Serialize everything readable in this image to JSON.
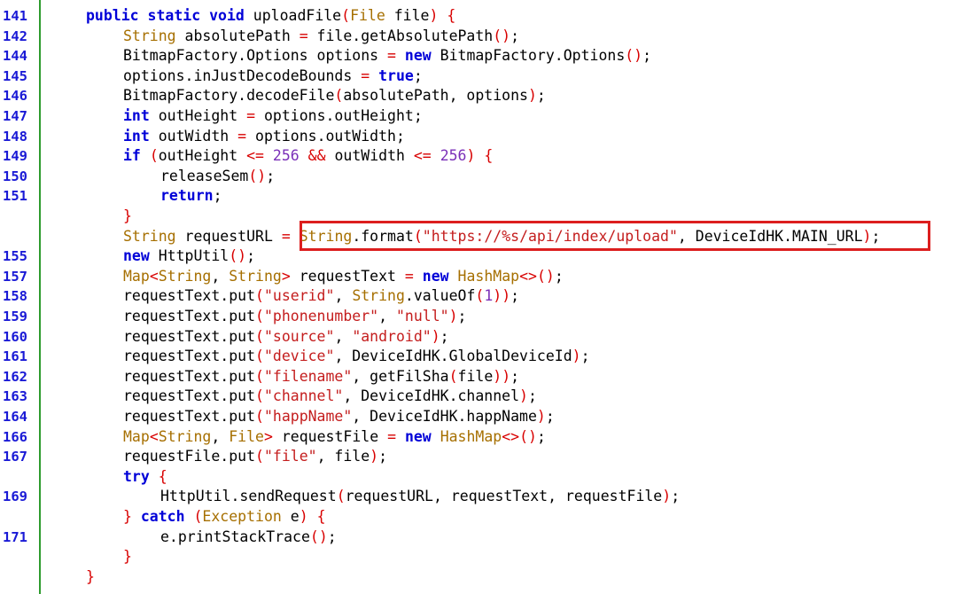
{
  "editor": {
    "lines": [
      {
        "num": "141",
        "indent": 0,
        "tokens": [
          [
            "kw",
            "public"
          ],
          [
            "p",
            " "
          ],
          [
            "kw",
            "static"
          ],
          [
            "p",
            " "
          ],
          [
            "kw",
            "void"
          ],
          [
            "p",
            " uploadFile"
          ],
          [
            "op",
            "("
          ],
          [
            "type",
            "File"
          ],
          [
            "p",
            " file"
          ],
          [
            "op",
            ")"
          ],
          [
            "p",
            " "
          ],
          [
            "op",
            "{"
          ]
        ]
      },
      {
        "num": "142",
        "indent": 1,
        "tokens": [
          [
            "type",
            "String"
          ],
          [
            "p",
            " absolutePath "
          ],
          [
            "op",
            "="
          ],
          [
            "p",
            " file.getAbsolutePath"
          ],
          [
            "op",
            "()"
          ],
          [
            "p",
            ";"
          ]
        ]
      },
      {
        "num": "144",
        "indent": 1,
        "tokens": [
          [
            "p",
            "BitmapFactory.Options options "
          ],
          [
            "op",
            "="
          ],
          [
            "p",
            " "
          ],
          [
            "kw",
            "new"
          ],
          [
            "p",
            " BitmapFactory.Options"
          ],
          [
            "op",
            "()"
          ],
          [
            "p",
            ";"
          ]
        ]
      },
      {
        "num": "145",
        "indent": 1,
        "tokens": [
          [
            "p",
            "options.inJustDecodeBounds "
          ],
          [
            "op",
            "="
          ],
          [
            "p",
            " "
          ],
          [
            "kw",
            "true"
          ],
          [
            "p",
            ";"
          ]
        ]
      },
      {
        "num": "146",
        "indent": 1,
        "tokens": [
          [
            "p",
            "BitmapFactory.decodeFile"
          ],
          [
            "op",
            "("
          ],
          [
            "p",
            "absolutePath, options"
          ],
          [
            "op",
            ")"
          ],
          [
            "p",
            ";"
          ]
        ]
      },
      {
        "num": "147",
        "indent": 1,
        "tokens": [
          [
            "kw",
            "int"
          ],
          [
            "p",
            " outHeight "
          ],
          [
            "op",
            "="
          ],
          [
            "p",
            " options.outHeight;"
          ]
        ]
      },
      {
        "num": "148",
        "indent": 1,
        "tokens": [
          [
            "kw",
            "int"
          ],
          [
            "p",
            " outWidth "
          ],
          [
            "op",
            "="
          ],
          [
            "p",
            " options.outWidth;"
          ]
        ]
      },
      {
        "num": "149",
        "indent": 1,
        "tokens": [
          [
            "kw",
            "if"
          ],
          [
            "p",
            " "
          ],
          [
            "op",
            "("
          ],
          [
            "p",
            "outHeight "
          ],
          [
            "op",
            "<="
          ],
          [
            "p",
            " "
          ],
          [
            "num",
            "256"
          ],
          [
            "p",
            " "
          ],
          [
            "op",
            "&&"
          ],
          [
            "p",
            " outWidth "
          ],
          [
            "op",
            "<="
          ],
          [
            "p",
            " "
          ],
          [
            "num",
            "256"
          ],
          [
            "op",
            ")"
          ],
          [
            "p",
            " "
          ],
          [
            "op",
            "{"
          ]
        ]
      },
      {
        "num": "150",
        "indent": 2,
        "tokens": [
          [
            "p",
            "releaseSem"
          ],
          [
            "op",
            "()"
          ],
          [
            "p",
            ";"
          ]
        ]
      },
      {
        "num": "151",
        "indent": 2,
        "tokens": [
          [
            "kw",
            "return"
          ],
          [
            "p",
            ";"
          ]
        ]
      },
      {
        "num": "",
        "indent": 1,
        "tokens": [
          [
            "op",
            "}"
          ]
        ]
      },
      {
        "num": "",
        "indent": 1,
        "tokens": [
          [
            "type",
            "String"
          ],
          [
            "p",
            " requestURL "
          ],
          [
            "op",
            "="
          ],
          [
            "p",
            " "
          ],
          [
            "type",
            "String"
          ],
          [
            "p",
            ".format"
          ],
          [
            "op",
            "("
          ],
          [
            "str",
            "\"https://%s/api/index/upload\""
          ],
          [
            "p",
            ", DeviceIdHK.MAIN_URL"
          ],
          [
            "op",
            ")"
          ],
          [
            "p",
            ";"
          ]
        ]
      },
      {
        "num": "155",
        "indent": 1,
        "tokens": [
          [
            "kw",
            "new"
          ],
          [
            "p",
            " HttpUtil"
          ],
          [
            "op",
            "()"
          ],
          [
            "p",
            ";"
          ]
        ]
      },
      {
        "num": "157",
        "indent": 1,
        "tokens": [
          [
            "type",
            "Map"
          ],
          [
            "op",
            "<"
          ],
          [
            "type",
            "String"
          ],
          [
            "p",
            ", "
          ],
          [
            "type",
            "String"
          ],
          [
            "op",
            ">"
          ],
          [
            "p",
            " requestText "
          ],
          [
            "op",
            "="
          ],
          [
            "p",
            " "
          ],
          [
            "kw",
            "new"
          ],
          [
            "p",
            " "
          ],
          [
            "type",
            "HashMap"
          ],
          [
            "op",
            "<>()"
          ],
          [
            "p",
            ";"
          ]
        ]
      },
      {
        "num": "158",
        "indent": 1,
        "tokens": [
          [
            "p",
            "requestText.put"
          ],
          [
            "op",
            "("
          ],
          [
            "str",
            "\"userid\""
          ],
          [
            "p",
            ", "
          ],
          [
            "type",
            "String"
          ],
          [
            "p",
            ".valueOf"
          ],
          [
            "op",
            "("
          ],
          [
            "num",
            "1"
          ],
          [
            "op",
            "))"
          ],
          [
            "p",
            ";"
          ]
        ]
      },
      {
        "num": "159",
        "indent": 1,
        "tokens": [
          [
            "p",
            "requestText.put"
          ],
          [
            "op",
            "("
          ],
          [
            "str",
            "\"phonenumber\""
          ],
          [
            "p",
            ", "
          ],
          [
            "str",
            "\"null\""
          ],
          [
            "op",
            ")"
          ],
          [
            "p",
            ";"
          ]
        ]
      },
      {
        "num": "160",
        "indent": 1,
        "tokens": [
          [
            "p",
            "requestText.put"
          ],
          [
            "op",
            "("
          ],
          [
            "str",
            "\"source\""
          ],
          [
            "p",
            ", "
          ],
          [
            "str",
            "\"android\""
          ],
          [
            "op",
            ")"
          ],
          [
            "p",
            ";"
          ]
        ]
      },
      {
        "num": "161",
        "indent": 1,
        "tokens": [
          [
            "p",
            "requestText.put"
          ],
          [
            "op",
            "("
          ],
          [
            "str",
            "\"device\""
          ],
          [
            "p",
            ", DeviceIdHK.GlobalDeviceId"
          ],
          [
            "op",
            ")"
          ],
          [
            "p",
            ";"
          ]
        ]
      },
      {
        "num": "162",
        "indent": 1,
        "tokens": [
          [
            "p",
            "requestText.put"
          ],
          [
            "op",
            "("
          ],
          [
            "str",
            "\"filename\""
          ],
          [
            "p",
            ", getFilSha"
          ],
          [
            "op",
            "("
          ],
          [
            "p",
            "file"
          ],
          [
            "op",
            "))"
          ],
          [
            "p",
            ";"
          ]
        ]
      },
      {
        "num": "163",
        "indent": 1,
        "tokens": [
          [
            "p",
            "requestText.put"
          ],
          [
            "op",
            "("
          ],
          [
            "str",
            "\"channel\""
          ],
          [
            "p",
            ", DeviceIdHK.channel"
          ],
          [
            "op",
            ")"
          ],
          [
            "p",
            ";"
          ]
        ]
      },
      {
        "num": "164",
        "indent": 1,
        "tokens": [
          [
            "p",
            "requestText.put"
          ],
          [
            "op",
            "("
          ],
          [
            "str",
            "\"happName\""
          ],
          [
            "p",
            ", DeviceIdHK.happName"
          ],
          [
            "op",
            ")"
          ],
          [
            "p",
            ";"
          ]
        ]
      },
      {
        "num": "166",
        "indent": 1,
        "tokens": [
          [
            "type",
            "Map"
          ],
          [
            "op",
            "<"
          ],
          [
            "type",
            "String"
          ],
          [
            "p",
            ", "
          ],
          [
            "type",
            "File"
          ],
          [
            "op",
            ">"
          ],
          [
            "p",
            " requestFile "
          ],
          [
            "op",
            "="
          ],
          [
            "p",
            " "
          ],
          [
            "kw",
            "new"
          ],
          [
            "p",
            " "
          ],
          [
            "type",
            "HashMap"
          ],
          [
            "op",
            "<>()"
          ],
          [
            "p",
            ";"
          ]
        ]
      },
      {
        "num": "167",
        "indent": 1,
        "tokens": [
          [
            "p",
            "requestFile.put"
          ],
          [
            "op",
            "("
          ],
          [
            "str",
            "\"file\""
          ],
          [
            "p",
            ", file"
          ],
          [
            "op",
            ")"
          ],
          [
            "p",
            ";"
          ]
        ]
      },
      {
        "num": "",
        "indent": 1,
        "tokens": [
          [
            "kw",
            "try"
          ],
          [
            "p",
            " "
          ],
          [
            "op",
            "{"
          ]
        ]
      },
      {
        "num": "169",
        "indent": 2,
        "tokens": [
          [
            "p",
            "HttpUtil.sendRequest"
          ],
          [
            "op",
            "("
          ],
          [
            "p",
            "requestURL, requestText, requestFile"
          ],
          [
            "op",
            ")"
          ],
          [
            "p",
            ";"
          ]
        ]
      },
      {
        "num": "",
        "indent": 1,
        "tokens": [
          [
            "op",
            "}"
          ],
          [
            "p",
            " "
          ],
          [
            "kw",
            "catch"
          ],
          [
            "p",
            " "
          ],
          [
            "op",
            "("
          ],
          [
            "type",
            "Exception"
          ],
          [
            "p",
            " e"
          ],
          [
            "op",
            ")"
          ],
          [
            "p",
            " "
          ],
          [
            "op",
            "{"
          ]
        ]
      },
      {
        "num": "171",
        "indent": 2,
        "tokens": [
          [
            "p",
            "e.printStackTrace"
          ],
          [
            "op",
            "()"
          ],
          [
            "p",
            ";"
          ]
        ]
      },
      {
        "num": "",
        "indent": 1,
        "tokens": [
          [
            "op",
            "}"
          ]
        ]
      },
      {
        "num": "",
        "indent": 0,
        "tokens": [
          [
            "op",
            "}"
          ]
        ]
      }
    ]
  },
  "colors": {
    "keyword": "#0000d8",
    "type": "#a66f00",
    "string": "#c41d1d",
    "number": "#7a2fb8",
    "operator": "#d80000",
    "line_number": "#1a1ad6",
    "gutter_border": "#2e9b2e",
    "highlight_box": "#dc1e1e"
  }
}
